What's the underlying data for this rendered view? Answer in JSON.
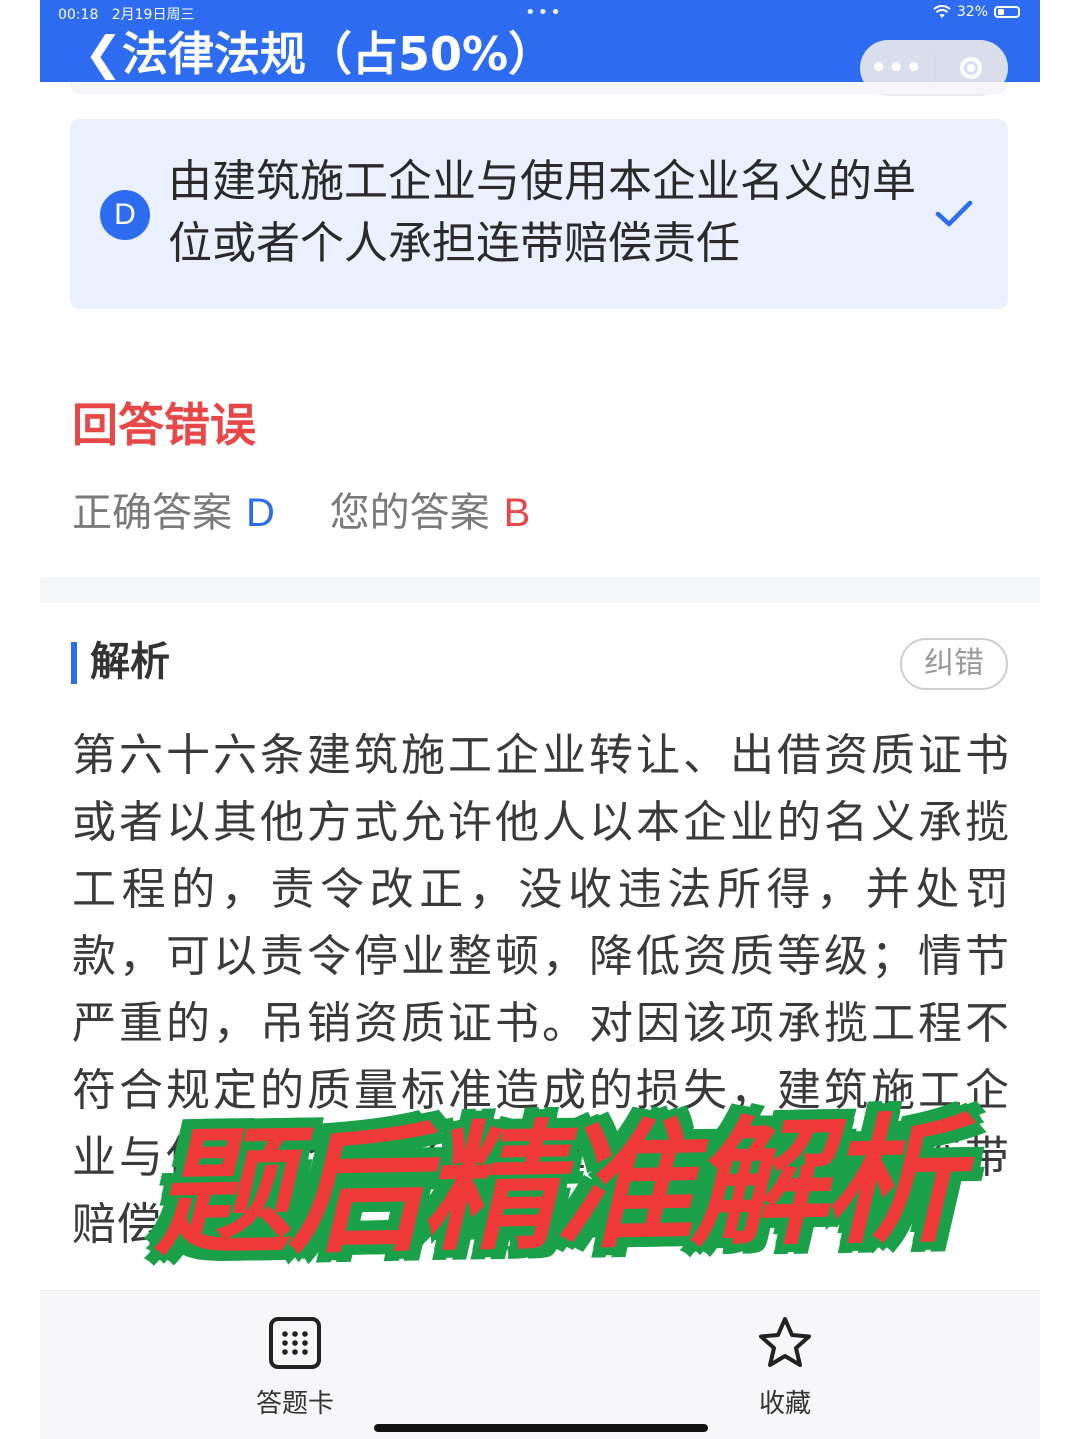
{
  "status_bar": {
    "time": "00:18",
    "date": "2月19日周三",
    "dots": "•••",
    "battery": "32%"
  },
  "header": {
    "back_symbol": "❮",
    "title": "法律法规（占50%）",
    "more_symbol": "•••",
    "brand_color": "#2d6cf0"
  },
  "option": {
    "letter": "D",
    "text": "由建筑施工企业与使用本企业名义的单位或者个人承担连带赔偿责任",
    "selected_icon": "check-icon"
  },
  "result": {
    "title": "回答错误",
    "correct_label": "正确答案",
    "correct_value": "D",
    "yours_label": "您的答案",
    "yours_value": "B",
    "error_color": "#e84747"
  },
  "analysis": {
    "title": "解析",
    "report_label": "纠错",
    "text": "第六十六条建筑施工企业转让、出借资质证书或者以其他方式允许他人以本企业的名义承揽工程的，责令改正，没收违法所得，并处罚款，可以责令停业整顿，降低资质等级；情节严重的，吊销资质证书。对因该项承揽工程不符合规定的质量标准造成的损失，建筑施工企业与使用本企业名义的单位或者个人承担连带赔偿责任。"
  },
  "overlay": {
    "text": "题后精准解析"
  },
  "bottom_bar": {
    "answer_card_label": "答题卡",
    "favorite_label": "收藏"
  }
}
